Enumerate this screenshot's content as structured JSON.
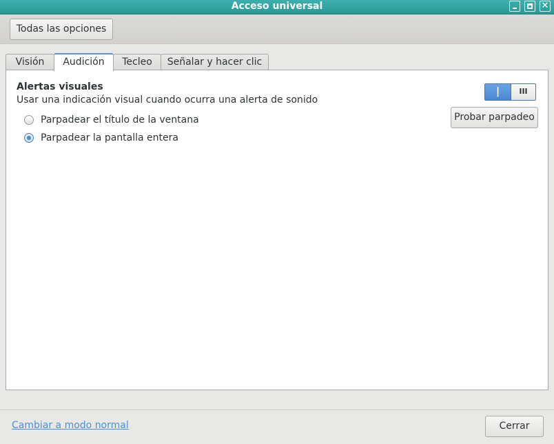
{
  "window": {
    "title": "Acceso universal",
    "controls": {
      "minimize": "minimize-icon",
      "maximize": "maximize-icon",
      "close": "✕"
    }
  },
  "toolbar": {
    "all_options_label": "Todas las opciones"
  },
  "tabs": [
    {
      "label": "Visión",
      "active": false
    },
    {
      "label": "Audición",
      "active": true
    },
    {
      "label": "Tecleo",
      "active": false
    },
    {
      "label": "Señalar y hacer clic",
      "active": false
    }
  ],
  "visual_alerts": {
    "title": "Alertas visuales",
    "description": "Usar una indicación visual cuando ocurra una alerta de sonido",
    "switch": {
      "on_glyph": "|",
      "off_glyph": "III",
      "state": "on"
    },
    "test_button": "Probar parpadeo",
    "options": [
      {
        "label": "Parpadear el título de la ventana",
        "selected": false
      },
      {
        "label": "Parpadear la pantalla entera",
        "selected": true
      }
    ]
  },
  "footer": {
    "switch_mode_link": "Cambiar a modo normal",
    "close_button": "Cerrar"
  },
  "colors": {
    "titlebar": "#2fa5a2",
    "accent": "#4a86d2",
    "link": "#4a90d9"
  }
}
